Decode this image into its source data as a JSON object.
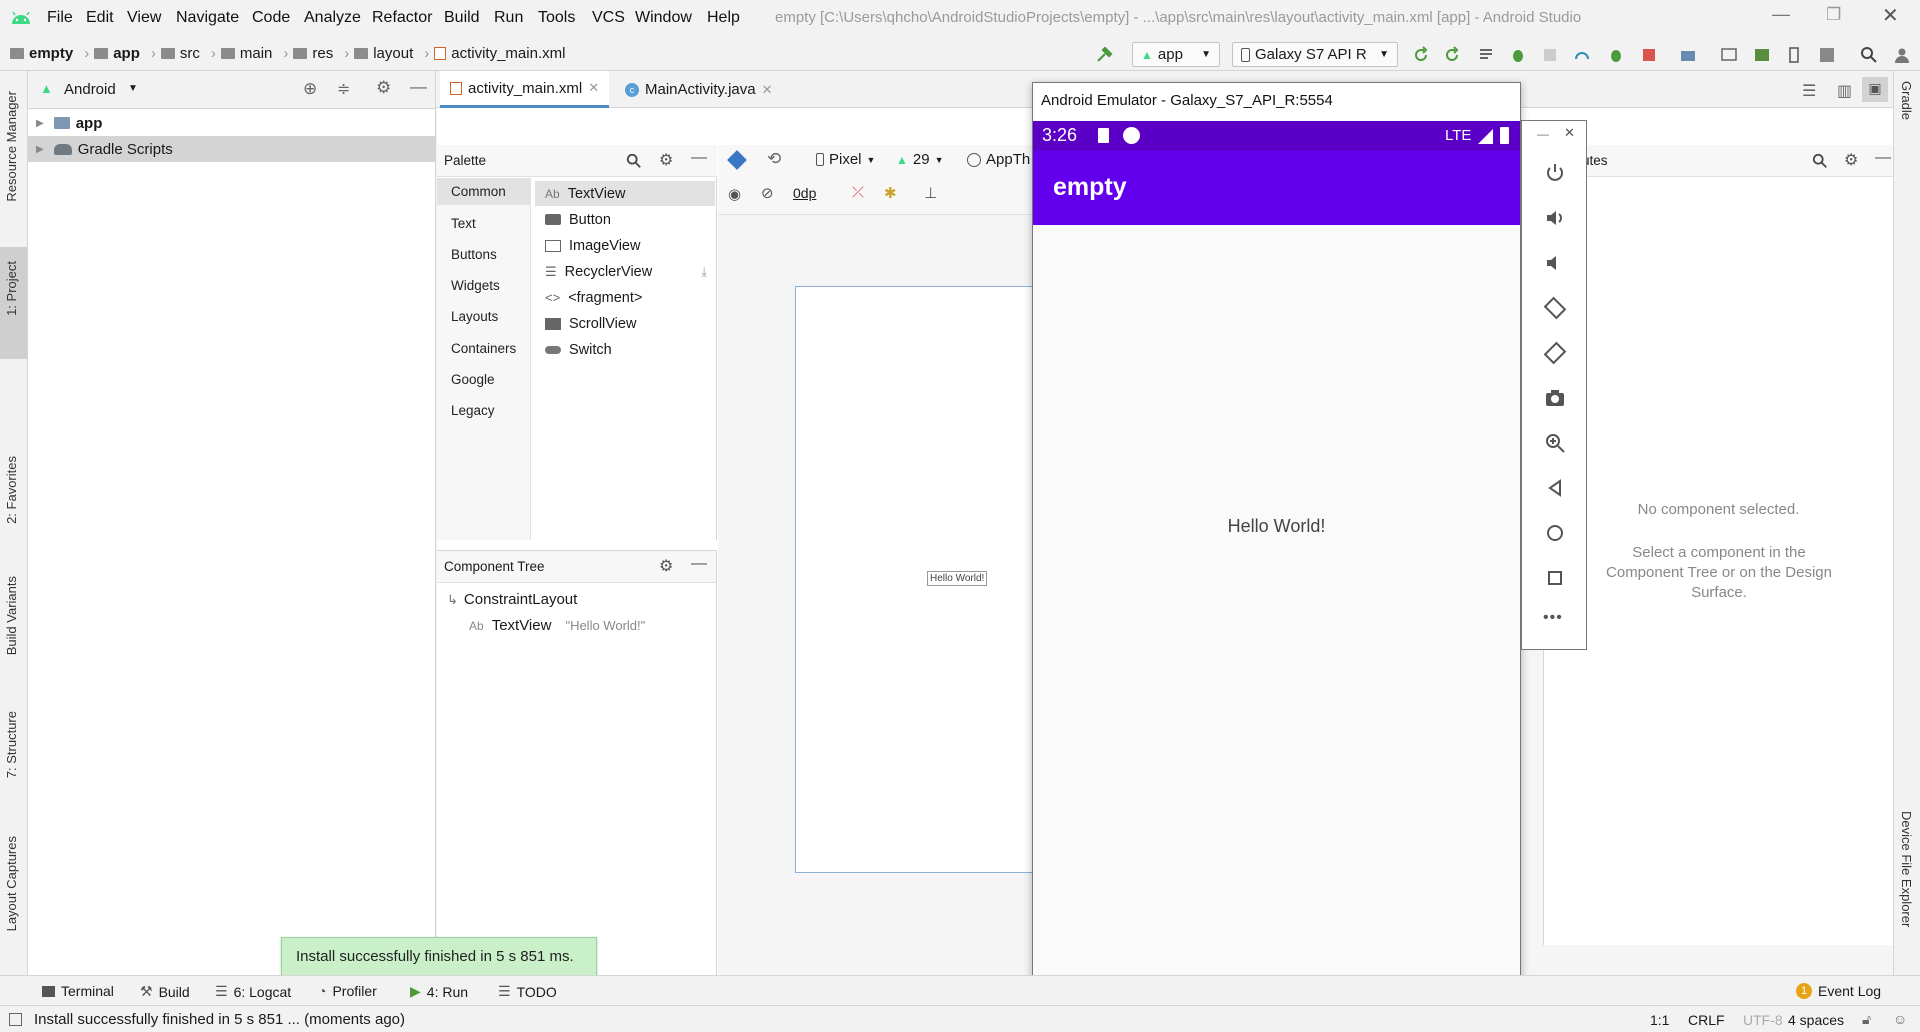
{
  "window": {
    "title": "empty [C:\\Users\\qhcho\\AndroidStudioProjects\\empty] - ...\\app\\src\\main\\res\\layout\\activity_main.xml [app] - Android Studio",
    "menu": [
      "File",
      "Edit",
      "View",
      "Navigate",
      "Code",
      "Analyze",
      "Refactor",
      "Build",
      "Run",
      "Tools",
      "VCS",
      "Window",
      "Help"
    ]
  },
  "breadcrumb": [
    "empty",
    "app",
    "src",
    "main",
    "res",
    "layout",
    "activity_main.xml"
  ],
  "toolbar": {
    "run_config": "app",
    "device": "Galaxy S7 API R"
  },
  "left_strip": {
    "tabs": [
      "Resource Manager",
      "1: Project",
      "2: Favorites",
      "Build Variants",
      "7: Structure",
      "Layout Captures"
    ]
  },
  "project": {
    "view_label": "Android",
    "tree": [
      "app",
      "Gradle Scripts"
    ]
  },
  "editor": {
    "tabs": [
      "activity_main.xml",
      "MainActivity.java"
    ]
  },
  "palette": {
    "title": "Palette",
    "categories": [
      "Common",
      "Text",
      "Buttons",
      "Widgets",
      "Layouts",
      "Containers",
      "Google",
      "Legacy"
    ],
    "items": [
      "TextView",
      "Button",
      "ImageView",
      "RecyclerView",
      "<fragment>",
      "ScrollView",
      "Switch"
    ]
  },
  "design_toolbar": {
    "device": "Pixel",
    "api": "29",
    "theme": "AppTh",
    "margin": "0dp"
  },
  "component_tree": {
    "title": "Component Tree",
    "root": "ConstraintLayout",
    "child_type": "TextView",
    "child_value": "\"Hello World!\""
  },
  "preview": {
    "text": "Hello World!"
  },
  "attributes": {
    "title_partial": "utes",
    "empty_title": "No component selected.",
    "empty_hint": "Select a component in the Component Tree or on the Design Surface."
  },
  "emulator": {
    "title": "Android Emulator - Galaxy_S7_API_R:5554",
    "time": "3:26",
    "network": "LTE",
    "app_title": "empty",
    "content_text": "Hello World!"
  },
  "right_strip": {
    "tabs": [
      "Gradle",
      "Device File Explorer"
    ]
  },
  "bottom_tools": [
    "Terminal",
    "Build",
    "6: Logcat",
    "Profiler",
    "4: Run",
    "TODO"
  ],
  "event_log": {
    "count": "1",
    "label": "Event Log"
  },
  "toast": "Install successfully finished in 5 s 851 ms.",
  "status": {
    "message": "Install successfully finished in 5 s 851 ... (moments ago)",
    "position": "1:1",
    "line_sep": "CRLF",
    "encoding": "UTF-8",
    "indent": "4 spaces"
  },
  "colors": {
    "accent": "#6200ee",
    "status_bar": "#5a00c7",
    "selection": "#d4d4d4",
    "android_green": "#3ddc84"
  }
}
